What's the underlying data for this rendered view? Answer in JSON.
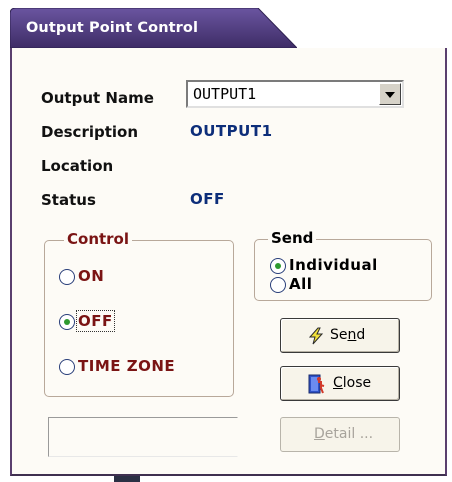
{
  "window": {
    "title": "Output Point Control"
  },
  "fields": {
    "output_name_label": "Output Name",
    "output_name_value": "OUTPUT1",
    "description_label": "Description",
    "description_value": "OUTPUT1",
    "location_label": "Location",
    "location_value": "",
    "status_label": "Status",
    "status_value": "OFF"
  },
  "control": {
    "legend": "Control",
    "options": [
      "ON",
      "OFF",
      "TIME ZONE"
    ],
    "selected": "OFF"
  },
  "send_group": {
    "legend": "Send",
    "options": [
      "Individual",
      "All"
    ],
    "selected": "Individual"
  },
  "buttons": {
    "send": {
      "label": "Send",
      "mnemonic": "n",
      "icon": "lightning-icon"
    },
    "close": {
      "label": "Close",
      "mnemonic": "C",
      "icon": "door-exit-icon"
    },
    "detail": {
      "label": "Detail ...",
      "mnemonic": "D",
      "enabled": false
    }
  },
  "colors": {
    "title_bar": "#4e3a78",
    "value_text": "#0d2e7a",
    "control_text": "#7a1414",
    "radio_check": "#2e9a2e",
    "panel_bg": "#fdfbf6"
  }
}
